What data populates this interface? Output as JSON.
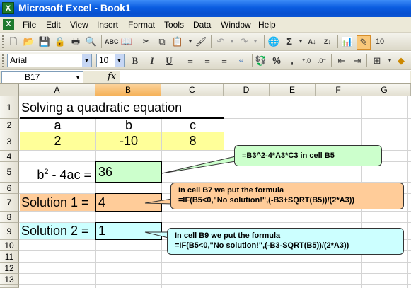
{
  "window": {
    "title": "Microsoft Excel - Book1"
  },
  "menu": [
    "File",
    "Edit",
    "View",
    "Insert",
    "Format",
    "Tools",
    "Data",
    "Window",
    "Help"
  ],
  "toolbar": {
    "font_name": "Arial",
    "font_size": "10",
    "bold": "B",
    "italic": "I",
    "underline": "U",
    "percent": "%",
    "comma": ",",
    "sigma": "Σ"
  },
  "formula_bar": {
    "name_box": "B17",
    "fx": "fx",
    "content": ""
  },
  "columns": [
    "A",
    "B",
    "C",
    "D",
    "E",
    "F",
    "G"
  ],
  "rows": [
    "1",
    "2",
    "3",
    "4",
    "5",
    "6",
    "7",
    "8",
    "9",
    "10",
    "11",
    "12",
    "13"
  ],
  "sheet": {
    "A1": "Solving a quadratic equation",
    "A2": "a",
    "B2": "b",
    "C2": "c",
    "A3": "2",
    "B3": "-10",
    "C3": "8",
    "A5_b": "b",
    "A5_sup": "2",
    "A5_rest": " - 4ac =",
    "B5": "36",
    "A7": "Solution 1 =",
    "B7": "4",
    "A9": "Solution 2 =",
    "B9": "1"
  },
  "callouts": {
    "b5": "=B3^2-4*A3*C3    in cell B5",
    "b7_line1": "In cell B7 we put the formula",
    "b7_line2": "=IF(B5<0,\"No solution!\",(-B3+SQRT(B5))/(2*A3))",
    "b9_line1": "In cell B9 we put the formula",
    "b9_line2": "=IF(B5<0,\"No solution!\",(-B3-SQRT(B5))/(2*A3))"
  },
  "colors": {
    "yellow": "#ffff99",
    "green": "#ccffcc",
    "orange": "#ffcc99",
    "cyan": "#ccffff",
    "callout_green": "#ccffcc",
    "callout_orange": "#ffcc99",
    "callout_cyan": "#ccffff"
  }
}
